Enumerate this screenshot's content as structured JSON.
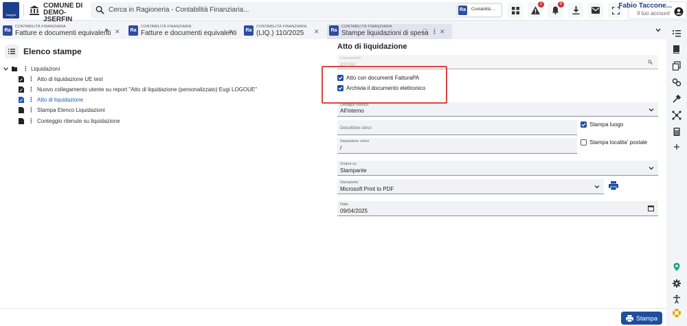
{
  "header": {
    "logo_text": "Maggioli",
    "org_name": "COMUNE DI DEMO-JSERFIN",
    "search_placeholder": "Cerca in Ragioneria - Contabilità Finanziaria...",
    "app_chip_label": "Contabilità ...",
    "notifications": {
      "alerts": "2",
      "bell": "8"
    },
    "user_name": "Fabio Taccone...",
    "user_role": "Il tuo account"
  },
  "tabs": [
    {
      "small": "CONTABILITÀ FINANZIARIA",
      "title": "Fatture e documenti equivalenti"
    },
    {
      "small": "CONTABILITÀ FINANZIARIA",
      "title": "Fatture e documenti equivalenti"
    },
    {
      "small": "CONTABILITÀ FINANZIARIA",
      "title": "(LIQ.) 110/2025"
    },
    {
      "small": "CONTABILITÀ FINANZIARIA",
      "title": "Stampe liquidazioni di spesa"
    }
  ],
  "left": {
    "title": "Elenco stampe",
    "root": "Liquidazioni",
    "items": [
      "Atto di liquidazione UE test",
      "Nuovo collegamento utente su report \"Atto di liquidazione (personalizzato) Eugi LOGOUE\"",
      "Atto di liquidazione",
      "Stampa Elenco Liquidazioni",
      "Conteggio ritenute su liquidazione"
    ]
  },
  "right": {
    "title": "Atto di liquidazione",
    "liquidazione": {
      "label": "Liquidazione",
      "value": "43160"
    },
    "checkbox_fatturapa": "Atto con documenti FatturaPA",
    "checkbox_archivia": "Archivia il documento elettronico",
    "dettaglio": {
      "label": "Dettaglio indirizzi",
      "value": "All'interno"
    },
    "descrittore": {
      "label": "Descrittore civico"
    },
    "stampa_luogo": "Stampa luogo",
    "separatore": {
      "label": "Separatore civico",
      "value": "/"
    },
    "stampa_localita": "Stampa localita' postale",
    "output": {
      "label": "Output su",
      "value": "Stampante"
    },
    "stampante": {
      "label": "Stampante",
      "value": "Microsoft Print to PDF"
    },
    "data": {
      "label": "Data",
      "value": "09/04/2025"
    }
  },
  "footer": {
    "stampa_label": "Stampa"
  }
}
